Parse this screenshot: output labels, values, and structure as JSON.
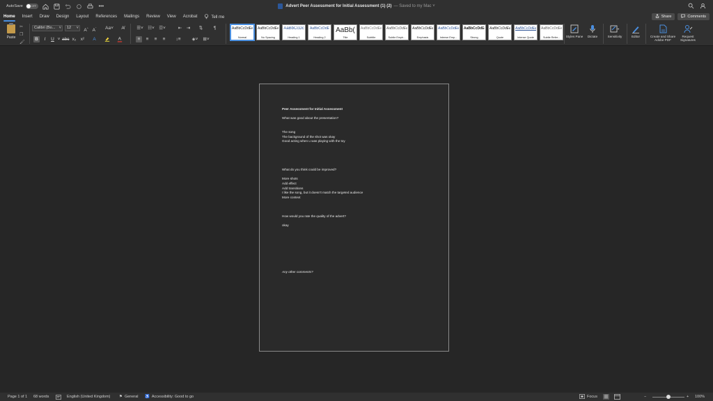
{
  "titlebar": {
    "autosave_label": "AutoSave",
    "autosave_state": "OFF",
    "document_name": "Advert Peer Assessment for Initial Assessment (1) (2)",
    "save_status": "— Saved to my Mac ˅",
    "more": "•••"
  },
  "tabs": [
    "Home",
    "Insert",
    "Draw",
    "Design",
    "Layout",
    "References",
    "Mailings",
    "Review",
    "View",
    "Acrobat"
  ],
  "tell_me": "Tell me",
  "top_buttons": {
    "share": "Share",
    "comments": "Comments"
  },
  "ribbon": {
    "paste_label": "Paste",
    "font_name": "Calibri (Bo...",
    "font_size": "12",
    "styles": [
      {
        "sample": "AaBbCcDdEe",
        "name": "Normal"
      },
      {
        "sample": "AaBbCcDdEe",
        "name": "No Spacing"
      },
      {
        "sample": "AaBbCcDc",
        "name": "Heading 1"
      },
      {
        "sample": "AaBbCcDdE",
        "name": "Heading 2"
      },
      {
        "sample": "AaBb(",
        "name": "Title"
      },
      {
        "sample": "AaBbCcDdEe",
        "name": "Subtitle"
      },
      {
        "sample": "AaBbCcDdEe",
        "name": "Subtle Emph..."
      },
      {
        "sample": "AaBbCcDdEe",
        "name": "Emphasis"
      },
      {
        "sample": "AaBbCcDdEe",
        "name": "Intense Emp..."
      },
      {
        "sample": "AaBbCcDdEe",
        "name": "Strong"
      },
      {
        "sample": "AaBbCcDdEe",
        "name": "Quote"
      },
      {
        "sample": "AaBbCcDdEe",
        "name": "Intense Quote"
      },
      {
        "sample": "AaBbCcDdEe",
        "name": "Subtle Refer..."
      }
    ],
    "styles_pane": "Styles Pane",
    "dictate": "Dictate",
    "sensitivity": "Sensitivity",
    "editor": "Editor",
    "create_share_pdf": "Create and Share Adobe PDF",
    "request_signatures": "Request Signatures"
  },
  "document": {
    "title": "Peer Assessment for Initial Assessment",
    "q1": "What was good about the presentation?",
    "a1": [
      "The song",
      "The background of the shot was okay",
      "Good acting when u was playing with the toy"
    ],
    "q2": "What do you think could be improved?",
    "a2": [
      "More shots",
      "Add effect",
      "Add transitions",
      "I like the song, but it doesn't match the targeted audience",
      "More context"
    ],
    "q3": "How would you rate the quality of the advert?",
    "a3": "okay",
    "q4": "Any other comments?"
  },
  "statusbar": {
    "page": "Page 1 of 1",
    "words": "68 words",
    "language": "English (United Kingdom)",
    "sensitivity": "General",
    "accessibility": "Accessibility: Good to go",
    "focus": "Focus",
    "zoom": "100%",
    "zoom_fraction": 0.5
  },
  "colors": {
    "accent": "#4a8fe0",
    "word_blue": "#2b579a",
    "chrome": "#303030",
    "canvas": "#262626"
  }
}
